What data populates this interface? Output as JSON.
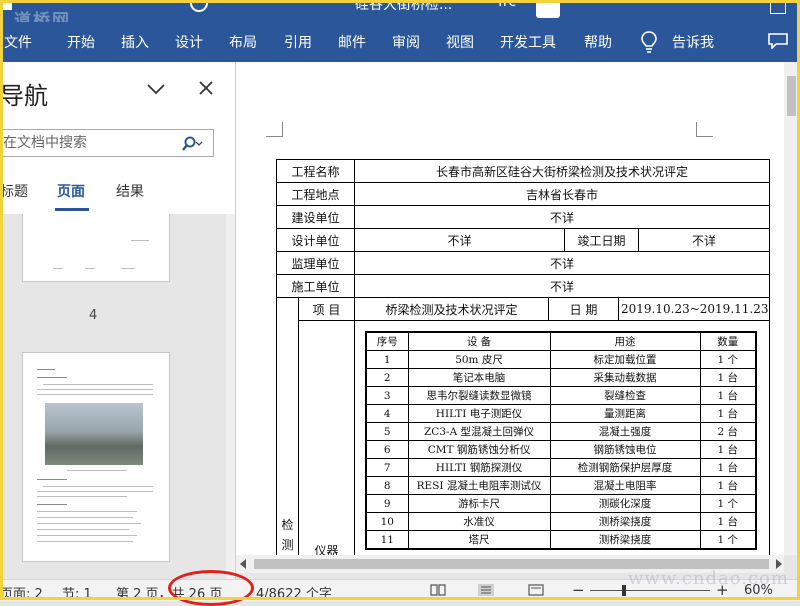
{
  "titlebar": {
    "watermark": "道桥网",
    "title": "硅谷大街桥检...",
    "user": "frc"
  },
  "ribbon": {
    "tabs": [
      "文件",
      "开始",
      "插入",
      "设计",
      "布局",
      "引用",
      "邮件",
      "审阅",
      "视图",
      "开发工具",
      "帮助"
    ],
    "tell_me": "告诉我"
  },
  "nav": {
    "title": "导航",
    "search_placeholder": "在文档中搜索",
    "tabs": [
      "标题",
      "页面",
      "结果"
    ],
    "active_tab": "页面",
    "thumb1_label": "4"
  },
  "doc": {
    "rows": {
      "project_name_label": "工程名称",
      "project_name": "长春市高新区硅谷大街桥梁检测及技术状况评定",
      "location_label": "工程地点",
      "location": "吉林省长春市",
      "build_unit_label": "建设单位",
      "build_unit": "不详",
      "design_unit_label": "设计单位",
      "design_unit": "不详",
      "completion_label": "竣工日期",
      "completion": "不详",
      "supervise_label": "监理单位",
      "supervise": "不详",
      "construct_label": "施工单位",
      "construct": "不详",
      "detect_label": "检测",
      "item_label": "项 目",
      "item_value": "桥梁检测及技术状况评定",
      "date_label": "日 期",
      "date_value": "2019.10.23~2019.11.23",
      "instrument_label": "仪器"
    },
    "instruments": {
      "headers": [
        "序号",
        "设 备",
        "用途",
        "数量"
      ],
      "rows": [
        [
          "1",
          "50m 皮尺",
          "标定加载位置",
          "1 个"
        ],
        [
          "2",
          "笔记本电脑",
          "采集动载数据",
          "1 台"
        ],
        [
          "3",
          "思韦尔裂缝读数显微镜",
          "裂缝检查",
          "1 台"
        ],
        [
          "4",
          "HILTI 电子测距仪",
          "量测距离",
          "1 台"
        ],
        [
          "5",
          "ZC3-A 型混凝土回弹仪",
          "混凝土强度",
          "2 台"
        ],
        [
          "6",
          "CMT 钢筋锈蚀分析仪",
          "钢筋锈蚀电位",
          "1 台"
        ],
        [
          "7",
          "HILTI 钢筋探测仪",
          "检测钢筋保护层厚度",
          "1 台"
        ],
        [
          "8",
          "RESI 混凝土电阻率测试仪",
          "混凝土电阻率",
          "1 台"
        ],
        [
          "9",
          "游标卡尺",
          "测碳化深度",
          "1 个"
        ],
        [
          "10",
          "水准仪",
          "测桥梁挠度",
          "1 台"
        ],
        [
          "11",
          "塔尺",
          "测桥梁挠度",
          "1 个"
        ]
      ]
    }
  },
  "status": {
    "page": "页面: 2",
    "section": "节: 1",
    "page_of": "第 2 页，共 26 页",
    "words": "4/8622 个字",
    "zoom": "60%",
    "watermark": "www.cndao.com"
  },
  "colors": {
    "ribbon": "#2b579a",
    "highlight_ring": "#e0201a",
    "frame": "#f4d23c"
  }
}
